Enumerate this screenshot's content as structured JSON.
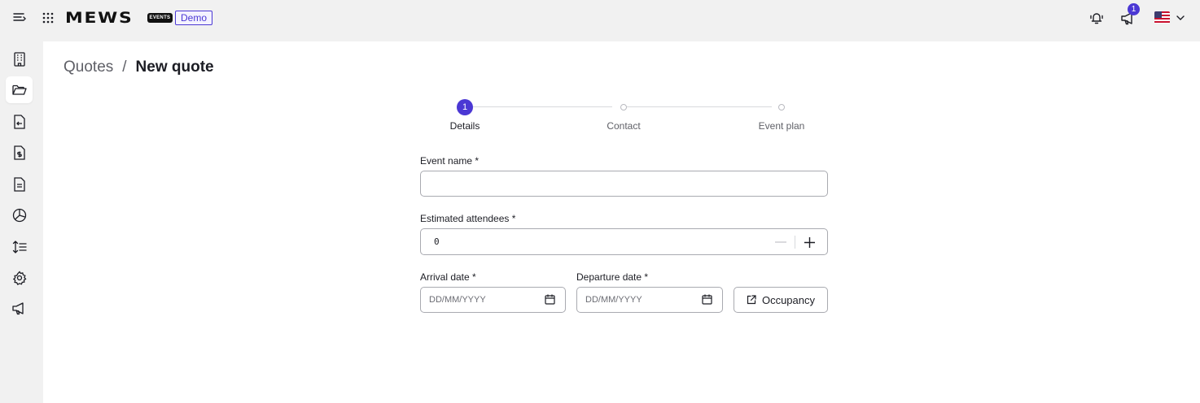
{
  "header": {
    "logo_text": "MEWS",
    "logo_badge": "EVENTS",
    "environment_badge": "Demo",
    "notification_count": "1"
  },
  "sidebar": {
    "items": [
      {
        "name": "building",
        "active": false
      },
      {
        "name": "folder",
        "active": true
      },
      {
        "name": "document-arrow",
        "active": false
      },
      {
        "name": "document-dollar",
        "active": false
      },
      {
        "name": "document-lines",
        "active": false
      },
      {
        "name": "pie-chart",
        "active": false
      },
      {
        "name": "sort-lines",
        "active": false
      },
      {
        "name": "settings",
        "active": false
      },
      {
        "name": "megaphone",
        "active": false
      }
    ]
  },
  "breadcrumb": {
    "parent": "Quotes",
    "separator": "/",
    "current": "New quote"
  },
  "stepper": {
    "current_step_number": "1",
    "steps": [
      {
        "label": "Details",
        "active": true
      },
      {
        "label": "Contact",
        "active": false
      },
      {
        "label": "Event plan",
        "active": false
      }
    ]
  },
  "form": {
    "event_name": {
      "label": "Event name *",
      "value": ""
    },
    "attendees": {
      "label": "Estimated attendees *",
      "value": "0"
    },
    "arrival": {
      "label": "Arrival date *",
      "placeholder": "DD/MM/YYYY"
    },
    "departure": {
      "label": "Departure date *",
      "placeholder": "DD/MM/YYYY"
    },
    "occupancy_button": "Occupancy"
  },
  "colors": {
    "accent": "#4b38d4",
    "background": "#f1f1f1",
    "panel": "#ffffff"
  }
}
